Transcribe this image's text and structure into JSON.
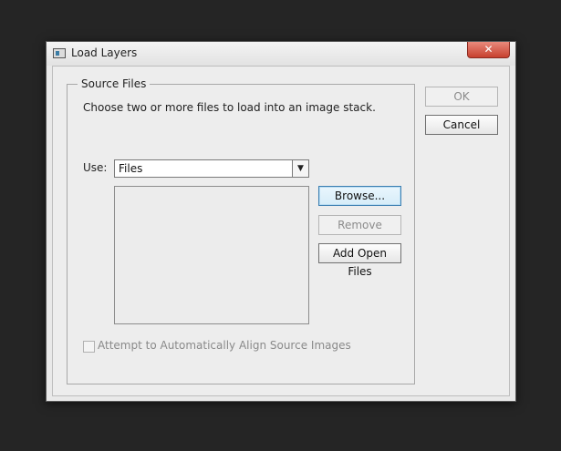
{
  "window": {
    "title": "Load Layers",
    "close_glyph": "✕"
  },
  "source_files": {
    "legend": "Source Files",
    "instructions": "Choose two or more files to load into an image stack.",
    "use_label": "Use:",
    "use_selected": "Files",
    "files": [],
    "browse_label": "Browse...",
    "remove_label": "Remove",
    "add_open_files_label": "Add Open Files",
    "align_checkbox_label": "Attempt to Automatically Align Source Images",
    "align_checked": false
  },
  "buttons": {
    "ok_label": "OK",
    "cancel_label": "Cancel"
  },
  "icons": {
    "app": "window-icon",
    "close": "close-icon",
    "dropdown": "chevron-down-icon"
  }
}
